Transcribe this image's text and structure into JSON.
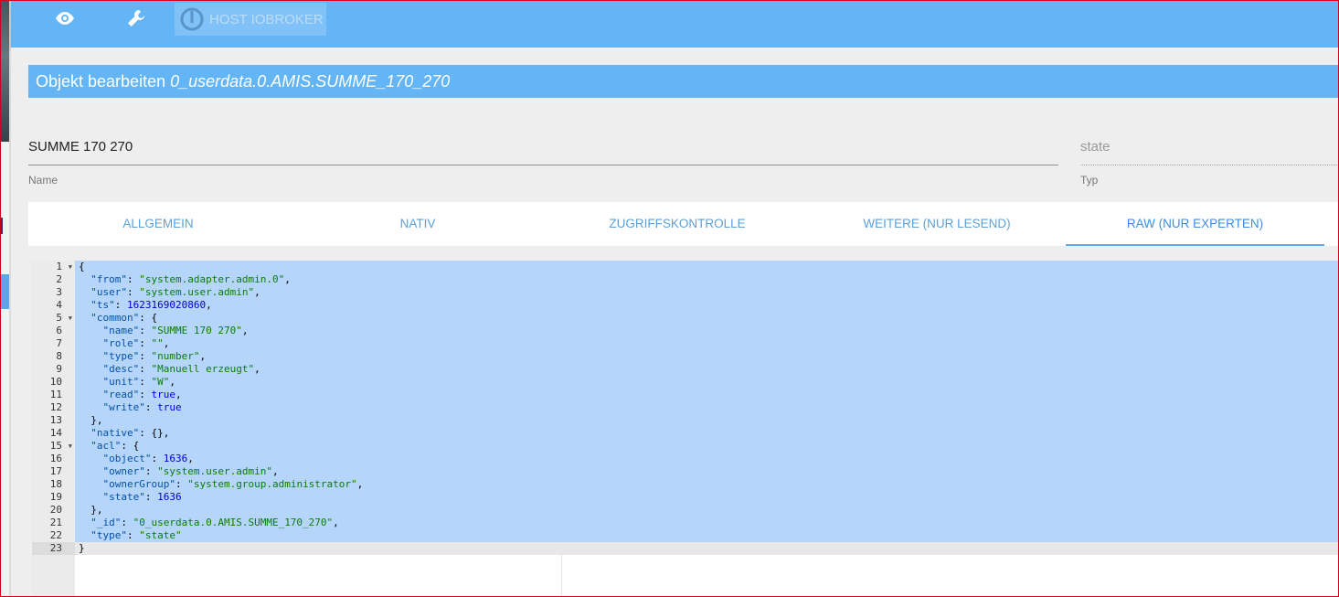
{
  "topbar": {
    "icons": [
      "eye-icon",
      "wrench-icon",
      "power-icon"
    ],
    "host_label": "HOST IOBROKER",
    "color": "#64b5f6"
  },
  "dialog": {
    "title_prefix": "Objekt bearbeiten",
    "object_id": "0_userdata.0.AMIS.SUMME_170_270",
    "name_value": "SUMME 170 270",
    "name_label": "Name",
    "type_value": "state",
    "type_label": "Typ"
  },
  "tabs": [
    {
      "label": "ALLGEMEIN"
    },
    {
      "label": "NATIV"
    },
    {
      "label": "ZUGRIFFSKONTROLLE"
    },
    {
      "label": "WEITERE (NUR LESEND)"
    },
    {
      "label": "RAW (NUR EXPERTEN)",
      "active": true
    }
  ],
  "editor": {
    "current_line": 23,
    "lines": [
      [
        [
          "p",
          "{"
        ]
      ],
      [
        [
          "p",
          "  "
        ],
        [
          "k",
          "\"from\""
        ],
        [
          "p",
          ": "
        ],
        [
          "s",
          "\"system.adapter.admin.0\""
        ],
        [
          "p",
          ","
        ]
      ],
      [
        [
          "p",
          "  "
        ],
        [
          "k",
          "\"user\""
        ],
        [
          "p",
          ": "
        ],
        [
          "s",
          "\"system.user.admin\""
        ],
        [
          "p",
          ","
        ]
      ],
      [
        [
          "p",
          "  "
        ],
        [
          "k",
          "\"ts\""
        ],
        [
          "p",
          ": "
        ],
        [
          "n",
          "1623169020860"
        ],
        [
          "p",
          ","
        ]
      ],
      [
        [
          "p",
          "  "
        ],
        [
          "k",
          "\"common\""
        ],
        [
          "p",
          ": {"
        ]
      ],
      [
        [
          "p",
          "    "
        ],
        [
          "k",
          "\"name\""
        ],
        [
          "p",
          ": "
        ],
        [
          "s",
          "\"SUMME 170 270\""
        ],
        [
          "p",
          ","
        ]
      ],
      [
        [
          "p",
          "    "
        ],
        [
          "k",
          "\"role\""
        ],
        [
          "p",
          ": "
        ],
        [
          "s",
          "\"\""
        ],
        [
          "p",
          ","
        ]
      ],
      [
        [
          "p",
          "    "
        ],
        [
          "k",
          "\"type\""
        ],
        [
          "p",
          ": "
        ],
        [
          "s",
          "\"number\""
        ],
        [
          "p",
          ","
        ]
      ],
      [
        [
          "p",
          "    "
        ],
        [
          "k",
          "\"desc\""
        ],
        [
          "p",
          ": "
        ],
        [
          "s",
          "\"Manuell erzeugt\""
        ],
        [
          "p",
          ","
        ]
      ],
      [
        [
          "p",
          "    "
        ],
        [
          "k",
          "\"unit\""
        ],
        [
          "p",
          ": "
        ],
        [
          "s",
          "\"W\""
        ],
        [
          "p",
          ","
        ]
      ],
      [
        [
          "p",
          "    "
        ],
        [
          "k",
          "\"read\""
        ],
        [
          "p",
          ": "
        ],
        [
          "b",
          "true"
        ],
        [
          "p",
          ","
        ]
      ],
      [
        [
          "p",
          "    "
        ],
        [
          "k",
          "\"write\""
        ],
        [
          "p",
          ": "
        ],
        [
          "b",
          "true"
        ]
      ],
      [
        [
          "p",
          "  },"
        ]
      ],
      [
        [
          "p",
          "  "
        ],
        [
          "k",
          "\"native\""
        ],
        [
          "p",
          ": {},"
        ]
      ],
      [
        [
          "p",
          "  "
        ],
        [
          "k",
          "\"acl\""
        ],
        [
          "p",
          ": {"
        ]
      ],
      [
        [
          "p",
          "    "
        ],
        [
          "k",
          "\"object\""
        ],
        [
          "p",
          ": "
        ],
        [
          "n",
          "1636"
        ],
        [
          "p",
          ","
        ]
      ],
      [
        [
          "p",
          "    "
        ],
        [
          "k",
          "\"owner\""
        ],
        [
          "p",
          ": "
        ],
        [
          "s",
          "\"system.user.admin\""
        ],
        [
          "p",
          ","
        ]
      ],
      [
        [
          "p",
          "    "
        ],
        [
          "k",
          "\"ownerGroup\""
        ],
        [
          "p",
          ": "
        ],
        [
          "s",
          "\"system.group.administrator\""
        ],
        [
          "p",
          ","
        ]
      ],
      [
        [
          "p",
          "    "
        ],
        [
          "k",
          "\"state\""
        ],
        [
          "p",
          ": "
        ],
        [
          "n",
          "1636"
        ]
      ],
      [
        [
          "p",
          "  },"
        ]
      ],
      [
        [
          "p",
          "  "
        ],
        [
          "k",
          "\"_id\""
        ],
        [
          "p",
          ": "
        ],
        [
          "s",
          "\"0_userdata.0.AMIS.SUMME_170_270\""
        ],
        [
          "p",
          ","
        ]
      ],
      [
        [
          "p",
          "  "
        ],
        [
          "k",
          "\"type\""
        ],
        [
          "p",
          ": "
        ],
        [
          "s",
          "\"state\""
        ]
      ],
      [
        [
          "p",
          "}"
        ]
      ]
    ],
    "line_numbers": [
      "1",
      "2",
      "3",
      "4",
      "5",
      "6",
      "7",
      "8",
      "9",
      "10",
      "11",
      "12",
      "13",
      "14",
      "15",
      "16",
      "17",
      "18",
      "19",
      "20",
      "21",
      "22",
      "23"
    ],
    "foldable_lines": [
      1,
      5,
      15
    ]
  }
}
